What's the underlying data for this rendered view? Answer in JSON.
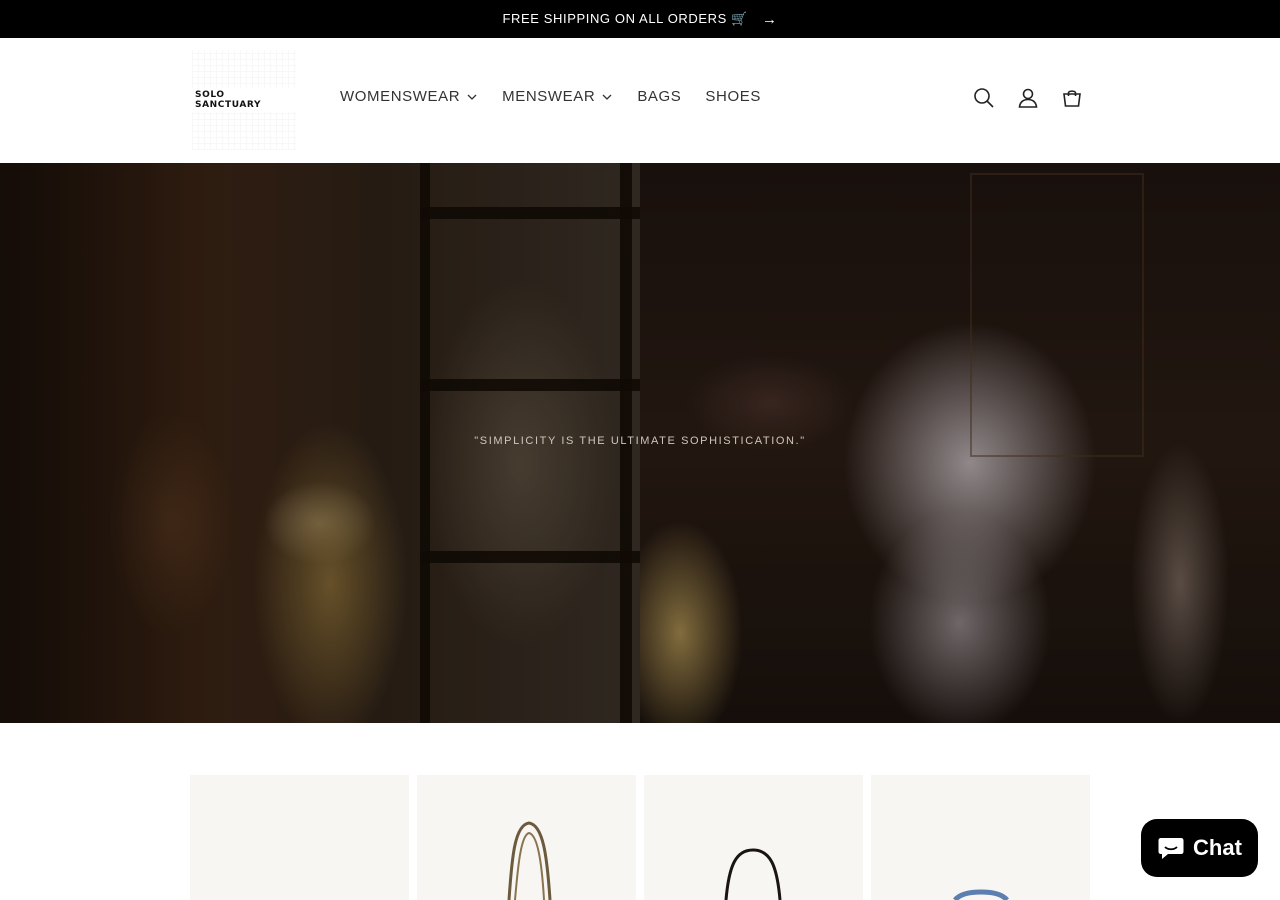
{
  "announcement": {
    "text": "FREE SHIPPING ON ALL ORDERS 🛒",
    "arrow": "→"
  },
  "header": {
    "logo_text": "SOLO SANCTUARY",
    "nav": [
      {
        "label": "WOMENSWEAR",
        "has_dropdown": true
      },
      {
        "label": "MENSWEAR",
        "has_dropdown": true
      },
      {
        "label": "BAGS",
        "has_dropdown": false
      },
      {
        "label": "SHOES",
        "has_dropdown": false
      }
    ],
    "icons": [
      "search-icon",
      "account-icon",
      "cart-icon"
    ]
  },
  "hero": {
    "quote": "\"SIMPLICITY IS THE ULTIMATE SOPHISTICATION.\""
  },
  "products": {
    "cards": [
      {
        "image": "blank"
      },
      {
        "image": "handbag"
      },
      {
        "image": "handbag"
      },
      {
        "image": "handbag"
      }
    ]
  },
  "chat": {
    "label": "Chat",
    "icon": "chat-bubble-icon",
    "bg": "#000000"
  },
  "colors": {
    "announcement_bg": "#000000",
    "card_bg": "#f8f6f2"
  }
}
